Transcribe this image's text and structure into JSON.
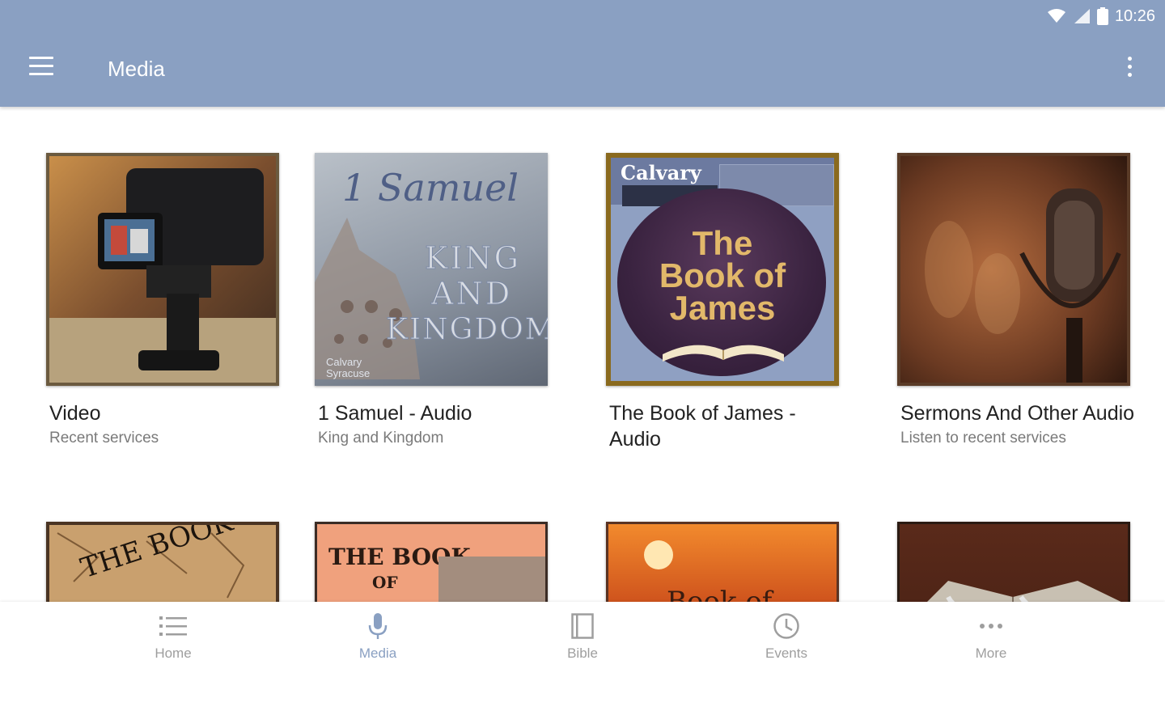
{
  "status_bar": {
    "time": "10:26"
  },
  "app_bar": {
    "title": "Media"
  },
  "media_items": [
    {
      "title": "Video",
      "subtitle": "Recent services"
    },
    {
      "title": "1 Samuel - Audio",
      "subtitle": "King and Kingdom",
      "art_text": {
        "line1": "1 Samuel",
        "line2": "KING",
        "line3": "AND",
        "line4": "KINGDOM",
        "brand": "Calvary Syracuse"
      }
    },
    {
      "title": "The Book of James - Audio",
      "subtitle": "",
      "art_text": {
        "brand": "Calvary",
        "line1": "The",
        "line2": "Book of",
        "line3": "James"
      }
    },
    {
      "title": "Sermons And Other Audio",
      "subtitle": "Listen to recent services"
    },
    {
      "title": "",
      "subtitle": "",
      "art_text": {
        "line1": "THE BOOK O"
      }
    },
    {
      "title": "",
      "subtitle": "",
      "art_text": {
        "line1": "THE BOOK",
        "line2": "OF"
      }
    },
    {
      "title": "",
      "subtitle": "",
      "art_text": {
        "line1": "Book of"
      }
    },
    {
      "title": "",
      "subtitle": ""
    }
  ],
  "bottom_nav": [
    {
      "label": "Home",
      "icon": "list-icon"
    },
    {
      "label": "Media",
      "icon": "microphone-icon",
      "active": true
    },
    {
      "label": "Bible",
      "icon": "book-icon"
    },
    {
      "label": "Events",
      "icon": "clock-icon"
    },
    {
      "label": "More",
      "icon": "more-horizontal-icon"
    }
  ],
  "colors": {
    "primary": "#8aa0c2",
    "inactive": "#9e9e9e"
  }
}
